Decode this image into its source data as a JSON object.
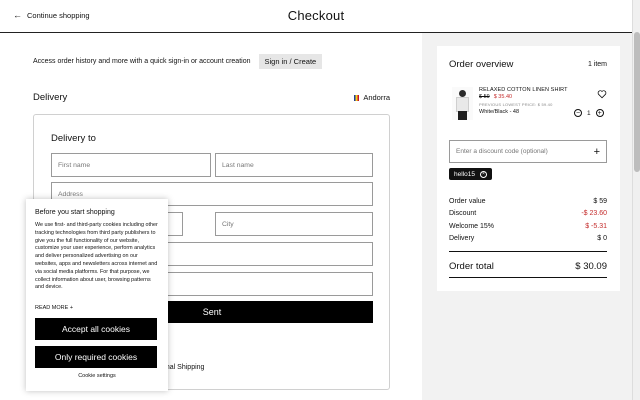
{
  "header": {
    "back_arrow": "←",
    "back_label": "Continue shopping",
    "title": "Checkout"
  },
  "account": {
    "prompt": "Access order history and more with a quick sign-in or account creation",
    "signin_button": "Sign in / Create"
  },
  "delivery": {
    "section_title": "Delivery",
    "country": "Andorra",
    "card_title": "Delivery to",
    "fields": {
      "first_name": "First name",
      "last_name": "Last name",
      "address": "Address",
      "postal_code": "",
      "city": "City",
      "field_a": "",
      "field_b": ""
    },
    "submit_button": "Sent",
    "shipping_option": "onal Shipping"
  },
  "order": {
    "title": "Order overview",
    "count": "1 item",
    "product": {
      "name": "RELAXED COTTON LINEN SHIRT",
      "old_price": "$ 59",
      "new_price": "$ 35.40",
      "lowest_price": "PREVIOUS LOWEST PRICE: $ 59.40",
      "variant": "White/Black - 48",
      "quantity": "1",
      "minus_symbol": "−",
      "plus_symbol": "+"
    },
    "discount_placeholder": "Enter a discount code (optional)",
    "discount_plus": "+",
    "applied_code": "hello15",
    "remove_symbol": "×",
    "summary": [
      {
        "label": "Order value",
        "value": "$ 59",
        "negative": false
      },
      {
        "label": "Discount",
        "value": "-$ 23.60",
        "negative": true
      },
      {
        "label": "Welcome 15%",
        "value": "$ -5.31",
        "negative": true
      },
      {
        "label": "Delivery",
        "value": "$ 0",
        "negative": false
      }
    ],
    "total_label": "Order total",
    "total_value": "$ 30.09"
  },
  "cookie": {
    "title": "Before you start shopping",
    "text": "We use first- and third-party cookies including other tracking technologies from third party publishers to give you the full functionality of our website, customize your user experience, perform analytics and deliver personalized advertising on our websites, apps and newsletters across internet and via social media platforms. For that purpose, we collect information about user, browsing patterns and device.",
    "read_more": "READ MORE +",
    "accept_all": "Accept all cookies",
    "only_required": "Only required cookies",
    "settings": "Cookie settings"
  },
  "colors": {
    "accent": "#000000",
    "discount_red": "#c42b2b",
    "panel_bg": "#f2f2f2"
  }
}
